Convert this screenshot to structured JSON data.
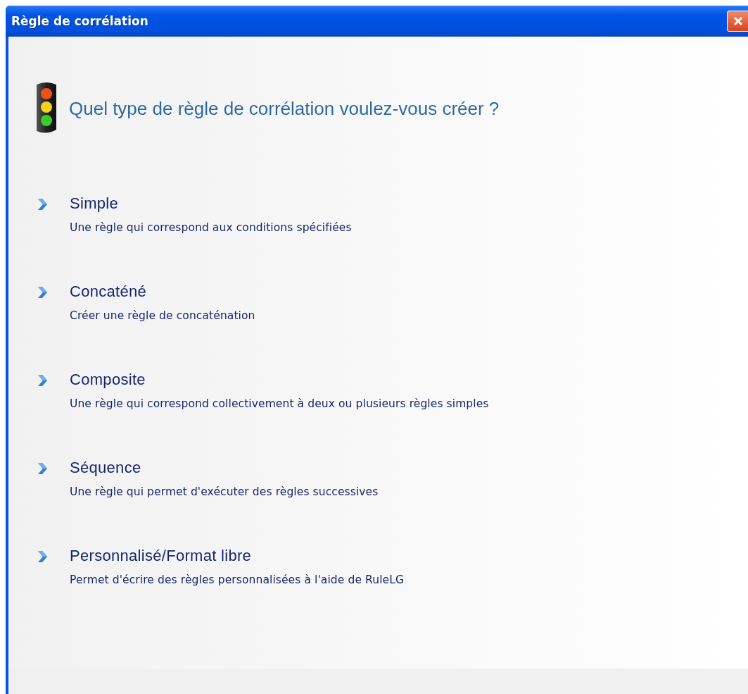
{
  "window": {
    "title": "Règle de corrélation"
  },
  "heading": "Quel type de règle de corrélation voulez-vous créer ?",
  "options": [
    {
      "title": "Simple",
      "description": "Une règle qui correspond aux conditions spécifiées"
    },
    {
      "title": "Concaténé",
      "description": "Créer une règle de concaténation"
    },
    {
      "title": "Composite",
      "description": "Une règle qui correspond collectivement à deux ou plusieurs règles simples"
    },
    {
      "title": "Séquence",
      "description": "Une règle qui permet d'exécuter des règles successives"
    },
    {
      "title": "Personnalisé/Format libre",
      "description": "Permet d'écrire des règles personnalisées à l'aide de RuleLG"
    }
  ]
}
